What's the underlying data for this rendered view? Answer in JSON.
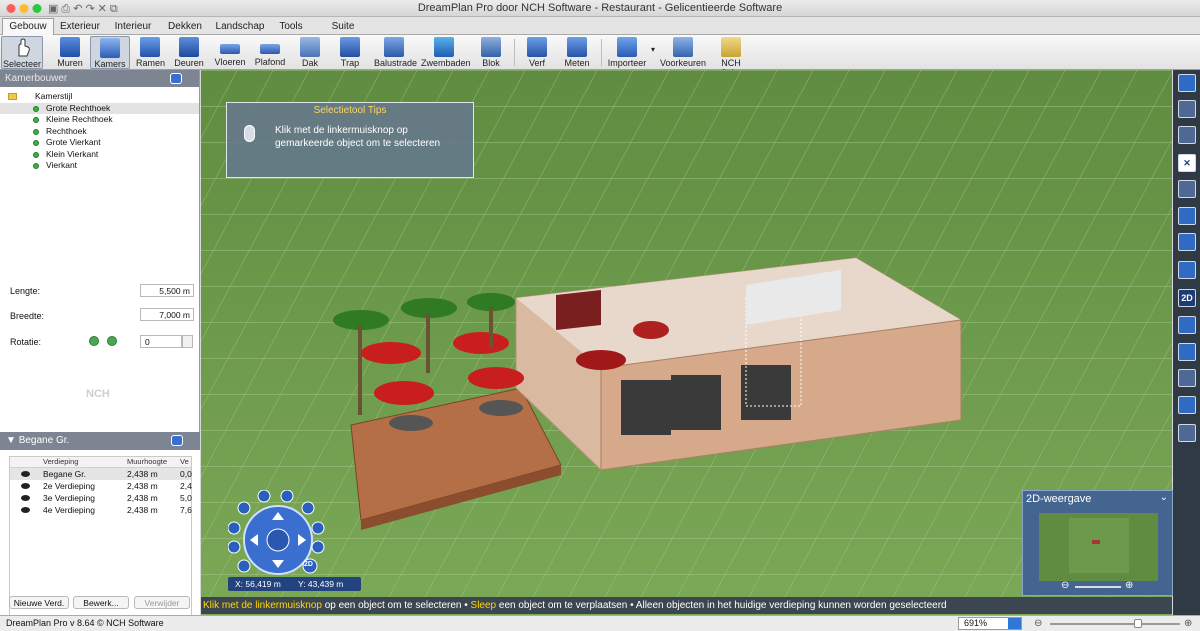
{
  "window": {
    "title": "DreamPlan Pro door NCH Software - Restaurant - Gelicentieerde Software"
  },
  "tabs": [
    "Gebouw",
    "Exterieur",
    "Interieur",
    "Dekken",
    "Landschap",
    "Tools",
    "Suite"
  ],
  "ribbon": [
    {
      "label": "Selecteer",
      "icon": "hand-pointer-icon",
      "selected": true
    },
    {
      "label": "Muren",
      "icon": "wall-icon"
    },
    {
      "label": "Kamers",
      "icon": "room-icon",
      "selected": true
    },
    {
      "label": "Ramen",
      "icon": "window-icon"
    },
    {
      "label": "Deuren",
      "icon": "door-icon"
    },
    {
      "label": "Vloeren",
      "icon": "floor-icon"
    },
    {
      "label": "Plafond",
      "icon": "ceiling-icon"
    },
    {
      "label": "Dak",
      "icon": "roof-icon"
    },
    {
      "label": "Trap",
      "icon": "stairs-icon"
    },
    {
      "label": "Balustrade",
      "icon": "railing-icon"
    },
    {
      "label": "Zwembaden",
      "icon": "pool-icon"
    },
    {
      "label": "Blok",
      "icon": "block-icon"
    },
    {
      "label": "Verf",
      "icon": "paint-roller-icon"
    },
    {
      "label": "Meten",
      "icon": "measure-icon"
    },
    {
      "label": "Importeer",
      "icon": "import-icon"
    },
    {
      "label": "Voorkeuren",
      "icon": "preferences-icon"
    },
    {
      "label": "NCH Suite",
      "icon": "nch-suite-icon"
    }
  ],
  "room_builder": {
    "title": "Kamerbouwer",
    "category": "Kamerstijl",
    "items": [
      "Grote Rechthoek",
      "Kleine Rechthoek",
      "Rechthoek",
      "Grote Vierkant",
      "Klein Vierkant",
      "Vierkant"
    ],
    "selected_item": "Grote Rechthoek",
    "length_label": "Lengte:",
    "length_value": "5,500 m",
    "width_label": "Breedte:",
    "width_value": "7,000 m",
    "rotation_label": "Rotatie:",
    "rotation_value": "0",
    "logo": "NCH"
  },
  "floors": {
    "title": "Begane Gr.",
    "columns": [
      "Verdieping",
      "Muurhoogte",
      "Ve"
    ],
    "rows": [
      {
        "name": "Begane Gr.",
        "height": "2,438 m",
        "v": "0,0",
        "selected": true
      },
      {
        "name": "2e Verdieping",
        "height": "2,438 m",
        "v": "2,4"
      },
      {
        "name": "3e Verdieping",
        "height": "2,438 m",
        "v": "5,0"
      },
      {
        "name": "4e Verdieping",
        "height": "2,438 m",
        "v": "7,6"
      }
    ],
    "buttons": {
      "new": "Nieuwe Verd.",
      "edit": "Bewerk...",
      "delete": "Verwijder"
    }
  },
  "tips": {
    "title": "Selectietool Tips",
    "line1": "Klik met de linkermuisknop op",
    "line2": "gemarkeerde object om te selecteren"
  },
  "coords": {
    "x": "X: 56,419 m",
    "y": "Y: 43,439 m"
  },
  "status": {
    "part1": "Klik met de linkermuisknop",
    "part2": " op een object om te selecteren  •  ",
    "part3": "Sleep",
    "part4": " een object om te verplaatsen  •  Alleen objecten in het huidige verdieping kunnen worden geselecteerd"
  },
  "minimap": {
    "title": "2D-weergave"
  },
  "right_toolbar": [
    "select-icon",
    "undo-icon",
    "redo-icon",
    "close-icon",
    "copy-icon",
    "box-icon",
    "room-icon",
    "gear-icon",
    "2d-icon",
    "grid-icon",
    "pencil-icon",
    "snap-icon",
    "rotate-icon",
    "layers-icon"
  ],
  "right_toolbar_2d_label": "2D",
  "nav": {
    "label_2d": "2D"
  },
  "footer": {
    "version": "DreamPlan Pro v 8.64 © NCH Software",
    "zoom": "691%"
  },
  "colors": {
    "accent": "#2f6bc2",
    "status_highlight": "#ffd700",
    "grass": "#6f9b4c"
  }
}
